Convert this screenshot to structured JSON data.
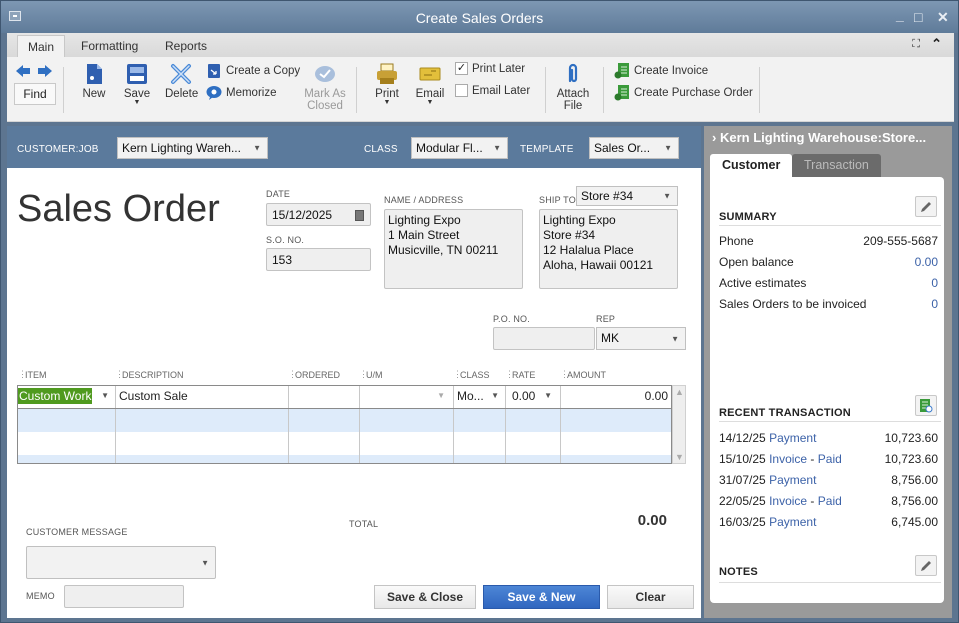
{
  "window": {
    "title": "Create Sales Orders",
    "controls": {
      "minimize": "_",
      "maximize": "□",
      "close": "✕"
    }
  },
  "ribbon": {
    "tabs": [
      {
        "label": "Main",
        "active": true
      },
      {
        "label": "Formatting",
        "active": false
      },
      {
        "label": "Reports",
        "active": false
      }
    ],
    "expand_icon": "⛶",
    "collapse_icon": "⌃"
  },
  "toolbar": {
    "find_label": "Find",
    "new_label": "New",
    "save_label": "Save",
    "delete_label": "Delete",
    "create_copy_label": "Create a Copy",
    "memorize_label": "Memorize",
    "mark_as_closed_line1": "Mark As",
    "mark_as_closed_line2": "Closed",
    "print_label": "Print",
    "email_label": "Email",
    "print_later_label": "Print Later",
    "print_later_checked": true,
    "email_later_label": "Email Later",
    "email_later_checked": false,
    "attach_file_line1": "Attach",
    "attach_file_line2": "File",
    "create_invoice_label": "Create Invoice",
    "create_po_label": "Create Purchase Order"
  },
  "header": {
    "customer_job_label": "CUSTOMER:JOB",
    "customer_job_value": "Kern Lighting Wareh...",
    "class_label": "CLASS",
    "class_value": "Modular Fl...",
    "template_label": "TEMPLATE",
    "template_value": "Sales Or..."
  },
  "form": {
    "doc_title": "Sales Order",
    "date_label": "DATE",
    "date_value": "15/12/2025",
    "so_no_label": "S.O. NO.",
    "so_no_value": "153",
    "name_address_label": "NAME / ADDRESS",
    "name_address_lines": [
      "Lighting Expo",
      "1 Main Street",
      "Musicville, TN 00211"
    ],
    "ship_to_label": "SHIP TO",
    "ship_to_value": "Store #34",
    "ship_to_lines": [
      "Lighting Expo",
      "Store #34",
      "12 Halalua Place",
      "Aloha, Hawaii 00121"
    ],
    "po_no_label": "P.O. NO.",
    "po_no_value": "",
    "rep_label": "REP",
    "rep_value": "MK"
  },
  "grid": {
    "columns": [
      "ITEM",
      "DESCRIPTION",
      "ORDERED",
      "U/M",
      "CLASS",
      "RATE",
      "AMOUNT"
    ],
    "rows": [
      {
        "item": "Custom Work",
        "description": "Custom Sale",
        "ordered": "",
        "um": "",
        "class": "Mo...",
        "rate": "0.00",
        "amount": "0.00"
      }
    ]
  },
  "footer": {
    "customer_message_label": "CUSTOMER MESSAGE",
    "customer_message_value": "",
    "memo_label": "MEMO",
    "memo_value": "",
    "total_label": "TOTAL",
    "total_value": "0.00",
    "save_close_label": "Save & Close",
    "save_new_label": "Save & New",
    "clear_label": "Clear"
  },
  "side_panel": {
    "header": "Kern Lighting Warehouse:Store...",
    "tabs": [
      {
        "label": "Customer",
        "active": true
      },
      {
        "label": "Transaction",
        "active": false
      }
    ],
    "summary": {
      "title": "SUMMARY",
      "rows": [
        {
          "label": "Phone",
          "value": "209-555-5687"
        },
        {
          "label": "Open balance",
          "value": "0.00"
        },
        {
          "label": "Active estimates",
          "value": "0"
        },
        {
          "label": "Sales Orders to be invoiced",
          "value": "0"
        }
      ]
    },
    "recent": {
      "title": "RECENT TRANSACTION",
      "rows": [
        {
          "date": "14/12/25",
          "type": "Payment",
          "status": "",
          "amount": "10,723.60"
        },
        {
          "date": "15/10/25",
          "type": "Invoice",
          "status": "Paid",
          "amount": "10,723.60"
        },
        {
          "date": "31/07/25",
          "type": "Payment",
          "status": "",
          "amount": "8,756.00"
        },
        {
          "date": "22/05/25",
          "type": "Invoice",
          "status": "Paid",
          "amount": "8,756.00"
        },
        {
          "date": "16/03/25",
          "type": "Payment",
          "status": "",
          "amount": "6,745.00"
        }
      ]
    },
    "notes": {
      "title": "NOTES"
    }
  },
  "colors": {
    "header_band": "#5b7a9c",
    "title_bar": "#6f8aa8",
    "item_highlight": "#4f9a1f",
    "row_alt": "#deebfa",
    "link": "#3c62a8",
    "primary_button": "#3a72c8"
  }
}
